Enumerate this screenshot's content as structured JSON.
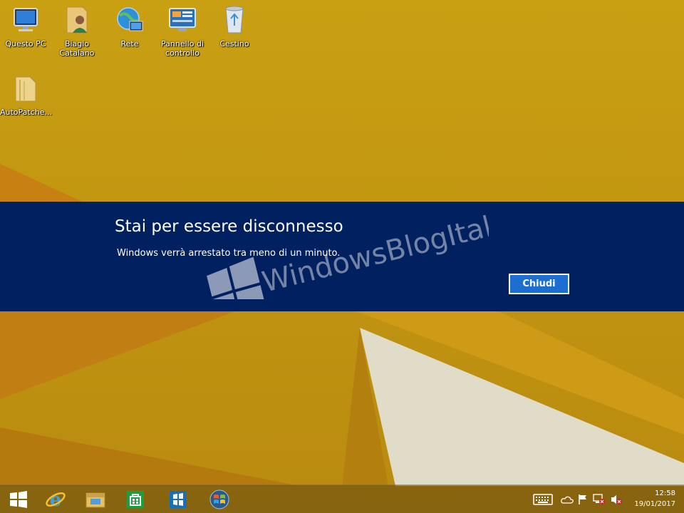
{
  "desktop": {
    "icons": [
      {
        "label": "Questo PC",
        "icon": "computer-icon"
      },
      {
        "label": "Biagio\nCatalano",
        "icon": "user-folder-icon"
      },
      {
        "label": "Rete",
        "icon": "network-icon"
      },
      {
        "label": "Pannello di\ncontrollo",
        "icon": "control-panel-icon"
      },
      {
        "label": "Cestino",
        "icon": "recycle-bin-icon"
      },
      {
        "label": "AutoPatche...",
        "icon": "folder-icon"
      }
    ]
  },
  "notification": {
    "title": "Stai per essere disconnesso",
    "message": "Windows verrà arrestato tra meno di un minuto.",
    "close_label": "Chiudi",
    "background": "#00205f",
    "button_color": "#1c6fd1"
  },
  "watermark": {
    "text": "WindowsBlogItalia"
  },
  "taskbar": {
    "pinned": [
      "windows-start-icon",
      "internet-explorer-icon",
      "file-explorer-icon",
      "windows-store-icon",
      "remote-app-icon",
      "windows7-logo-icon"
    ],
    "tray": [
      "keyboard-icon",
      "onedrive-icon",
      "action-center-flag-icon",
      "network-error-icon",
      "volume-muted-icon"
    ],
    "time": "12:58",
    "date": "19/01/2017"
  },
  "colors": {
    "wallpaper": "#c79a10"
  }
}
